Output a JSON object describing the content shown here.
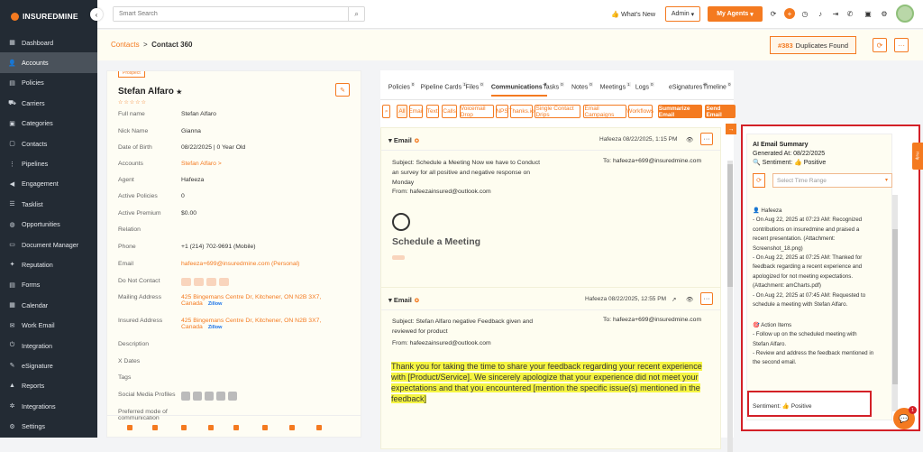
{
  "brand": {
    "name": "INSUREDMINE",
    "accent": "#f47a20",
    "sidebar_bg": "#232b34",
    "highlight_red": "#d32027"
  },
  "sidebar": {
    "items": [
      {
        "label": "Dashboard",
        "icon": "grid-icon"
      },
      {
        "label": "Accounts",
        "icon": "user-icon",
        "active": true
      },
      {
        "label": "Policies",
        "icon": "doc-icon"
      },
      {
        "label": "Carriers",
        "icon": "truck-icon"
      },
      {
        "label": "Categories",
        "icon": "tag-icon"
      },
      {
        "label": "Contacts",
        "icon": "contact-icon"
      },
      {
        "label": "Pipelines",
        "icon": "pipeline-icon"
      },
      {
        "label": "Engagement",
        "icon": "megaphone-icon"
      },
      {
        "label": "Tasklist",
        "icon": "list-icon"
      },
      {
        "label": "Opportunities",
        "icon": "globe-icon"
      },
      {
        "label": "Document Manager",
        "icon": "folder-icon"
      },
      {
        "label": "Reputation",
        "icon": "star-icon"
      },
      {
        "label": "Forms",
        "icon": "form-icon"
      },
      {
        "label": "Calendar",
        "icon": "calendar-icon"
      },
      {
        "label": "Work Email",
        "icon": "mail-icon"
      },
      {
        "label": "Integration",
        "icon": "plug-icon"
      },
      {
        "label": "eSignature",
        "icon": "pen-icon"
      },
      {
        "label": "Reports",
        "icon": "chart-icon"
      },
      {
        "label": "Integrations",
        "icon": "gears-icon"
      },
      {
        "label": "Settings",
        "icon": "gear-icon"
      }
    ]
  },
  "topbar": {
    "search_placeholder": "Smart Search",
    "whats_new": "What's New",
    "admin": "Admin",
    "my_agents": "My Agents"
  },
  "breadcrumb": {
    "parent": "Contacts",
    "separator": ">",
    "current": "Contact 360"
  },
  "duplicates": {
    "count": "#383",
    "label": "Duplicates Found"
  },
  "contact": {
    "badge": "Prospect",
    "name": "Stefan Alfaro",
    "fields": [
      {
        "label": "Full name",
        "value": "Stefan Alfaro"
      },
      {
        "label": "Nick Name",
        "value": "Gianna"
      },
      {
        "label": "Date of Birth",
        "value": "08/22/2025 | 0 Year Old"
      },
      {
        "label": "Accounts",
        "value": "Stefan Alfaro >",
        "orange": true
      },
      {
        "label": "Agent",
        "value": "Hafeeza"
      },
      {
        "label": "Active Policies",
        "value": "0"
      },
      {
        "label": "Active Premium",
        "value": "$0.00"
      },
      {
        "label": "Relation",
        "value": ""
      },
      {
        "label": "Phone",
        "value": "+1 (214) 702-9691 (Mobile)"
      },
      {
        "label": "Email",
        "value": "hafeeza+699@insuredmine.com  (Personal)",
        "orange": true
      },
      {
        "label": "Do Not Contact",
        "value": ""
      },
      {
        "label": "Mailing Address",
        "value": "425 Bingemans Centre Dr, Kitchener, ON N2B 3X7,",
        "value2": "Canada",
        "zillow": "Zillow",
        "orange": true
      },
      {
        "label": "Insured Address",
        "value": "425 Bingemans Centre Dr, Kitchener, ON N2B 3X7,",
        "value2": "Canada",
        "zillow": "Zillow",
        "orange": true
      },
      {
        "label": "Description",
        "value": ""
      },
      {
        "label": "X Dates",
        "value": ""
      },
      {
        "label": "Tags",
        "value": ""
      },
      {
        "label": "Social Media Profiles",
        "value": ""
      },
      {
        "label": "Preferred mode of",
        "label2": "communication",
        "value": ""
      }
    ]
  },
  "tabs": [
    {
      "label": "Policies",
      "count": "0"
    },
    {
      "label": "Pipeline Cards",
      "count": "1"
    },
    {
      "label": "Files",
      "count": "0"
    },
    {
      "label": "Communications",
      "count": "3",
      "active": true
    },
    {
      "label": "Tasks",
      "count": "0"
    },
    {
      "label": "Notes",
      "count": "0"
    },
    {
      "label": "Meetings",
      "count": "1"
    },
    {
      "label": "Logs",
      "count": "0"
    },
    {
      "label": "eSignatures",
      "count": "0"
    },
    {
      "label": "Timeline",
      "count": "0"
    }
  ],
  "filters": [
    "All",
    "Email",
    "Text",
    "Calls",
    "Voicemail Drop",
    "NPS",
    "Thanks.io",
    "Single Contact Drips",
    "Email Campaigns",
    "Workflows"
  ],
  "actions": {
    "summarize": "Summarize Email",
    "send": "Send Email"
  },
  "emails": [
    {
      "title": "Email",
      "meta": "Hafeeza 08/22/2025, 1:15 PM",
      "subject_lines": [
        "Subject: Schedule a Meeting Now we have to Conduct",
        "an survey for all positive and negative response on",
        "Monday"
      ],
      "to": "To: hafeeza+699@insuredmine.com",
      "from": "From: hafeezainsured@outlook.com",
      "heading": "Schedule a Meeting"
    },
    {
      "title": "Email",
      "meta": "Hafeeza 08/22/2025, 12:55 PM",
      "subject_lines": [
        "Subject: Stefan Alfaro negative Feedback given and",
        "reviewed for product"
      ],
      "to": "To: hafeeza+699@insuredmine.com",
      "from": "From: hafeezainsured@outlook.com",
      "body": "Thank you for taking the time to share your feedback regarding your recent experience with [Product/Service].  We sincerely apologize that your experience did not meet your expectations and that you encountered [mention the specific issue(s) mentioned in the feedback]"
    }
  ],
  "ai_summary": {
    "title": "AI Email Summary",
    "generated": "Generated At: 08/22/2025",
    "sentiment": "Sentiment: 👍 Positive",
    "time_range_placeholder": "Select Time Range",
    "lines": [
      "👤 Hafeeza",
      "- On Aug 22, 2025 at 07:23 AM: Recognized",
      "contributions on insuredmine and praised a",
      "recent presentation. (Attachment:",
      "Screenshot_18.png)",
      "- On Aug 22, 2025 at 07:25 AM: Thanked for",
      "feedback regarding a recent experience and",
      "apologized for not meeting expectations.",
      "(Attachment: amCharts.pdf)",
      "- On Aug 22, 2025 at 07:45 AM: Requested to",
      "schedule a meeting with Stefan Alfaro.",
      "",
      "🎯 Action Items",
      "- Follow up on the scheduled meeting with",
      "Stefan Alfaro.",
      "- Review and address the feedback mentioned in",
      "the second email."
    ],
    "bottom_sentiment": "Sentiment: 👍 Positive"
  },
  "help_tab": "Help",
  "chat_badge": "1"
}
